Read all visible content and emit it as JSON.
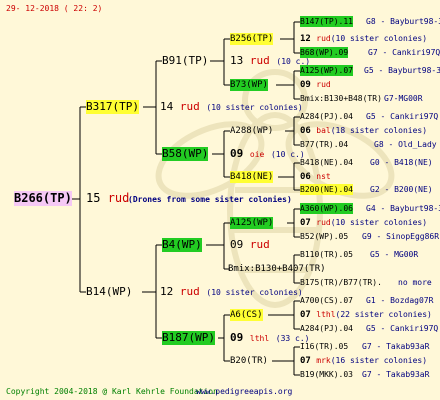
{
  "header": {
    "date": "29- 12-2018 ( 22: 2)"
  },
  "footer": {
    "copyright": "Copyright 2004-2018 @ Karl Kehrle Foundation",
    "url": "www.pedigreeapis.org"
  },
  "root": {
    "id": "B266(TP)",
    "num": "15",
    "word": "rud",
    "note": "(Drones from some sister colonies)"
  },
  "gen1": [
    {
      "id": "B317(TP)",
      "num": "14",
      "word": "rud",
      "note": "(10 sister colonies)"
    },
    {
      "id": "B14(WP)",
      "num": "12",
      "word": "rud",
      "note": "(10 sister colonies)"
    }
  ],
  "gen2": [
    {
      "id": "B91(TP)",
      "num": "13",
      "word": "rud",
      "note": "(10 c.)"
    },
    {
      "id": "B58(WP)",
      "num": "09",
      "word": "oie",
      "note": "(10 c.)"
    },
    {
      "id": "B4(WP)",
      "num": "09",
      "word": "rud",
      "note": ""
    },
    {
      "id": "B187(WP)",
      "num": "09",
      "word": "lthl",
      "note": "(33 c.)"
    }
  ],
  "gen3": [
    {
      "id": "B256(TP)",
      "num": "12",
      "word": "rud",
      "note": "(10 sister colonies)"
    },
    {
      "id": "B73(WP)",
      "num": "09",
      "word": "rud",
      "note": ""
    },
    {
      "id": "A288(WP)",
      "num": "06",
      "word": "bal",
      "note": "(18 sister colonies)"
    },
    {
      "id": "B418(NE)",
      "num": "06",
      "word": "nst",
      "note": ""
    },
    {
      "id": "A125(WP)",
      "num": "07",
      "word": "rud",
      "note": "(10 sister colonies)"
    },
    {
      "id": "Bmix:B130+B407(TR)",
      "num": "",
      "word": "",
      "note": ""
    },
    {
      "id": "A6(CS)",
      "num": "07",
      "word": "lthl",
      "note": "(22 sister colonies)"
    },
    {
      "id": "B20(TR)",
      "num": "07",
      "word": "mrk",
      "note": "(16 sister colonies)"
    }
  ],
  "gen4": [
    {
      "id": "B147(TP).11",
      "info": "G8 - Bayburt98-3"
    },
    {
      "id": "B68(WP).09",
      "info": "G7 - Cankiri97Q"
    },
    {
      "id": "A125(WP).07",
      "info": "G5 - Bayburt98-3"
    },
    {
      "id": "Bmix:B130+B48(TR)",
      "info": "G7-MG00R"
    },
    {
      "id": "A284(PJ).04",
      "info": "G5 - Cankiri97Q"
    },
    {
      "id": "B77(TR).04",
      "info": "G8 - Old_Lady"
    },
    {
      "id": "B418(NE).04",
      "info": "G0 - B418(NE)"
    },
    {
      "id": "B200(NE).04",
      "info": "G2 - B200(NE)"
    },
    {
      "id": "A360(WP).06",
      "info": "G4 - Bayburt98-3"
    },
    {
      "id": "B52(WP).05",
      "info": "G9 - SinopEgg86R"
    },
    {
      "id": "B110(TR).05",
      "info": "G5 - MG00R"
    },
    {
      "id": "B175(TR)/B77(TR).",
      "info": "no more"
    },
    {
      "id": "A700(CS).07",
      "info": "G1 - Bozdag07R"
    },
    {
      "id": "A284(PJ).04",
      "info": "G5 - Cankiri97Q"
    },
    {
      "id": "I16(TR).05",
      "info": "G7 - Takab93aR"
    },
    {
      "id": "B19(MKK).03",
      "info": "G7 - Takab93aR"
    }
  ]
}
